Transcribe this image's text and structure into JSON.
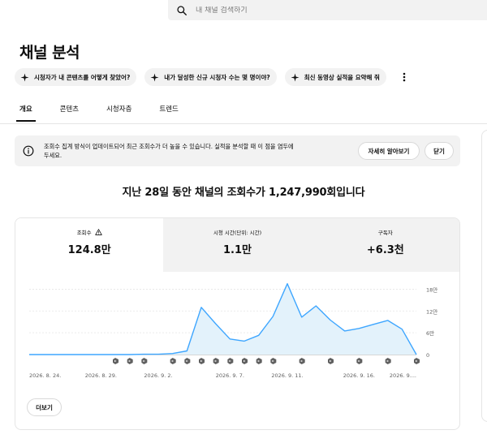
{
  "search": {
    "placeholder": "내 채널 검색하기"
  },
  "page_title": "채널 분석",
  "chips": [
    {
      "label": "시청자가 내 콘텐츠를 어떻게 찾았어?"
    },
    {
      "label": "내가 달성한 신규 시청자 수는 몇 명이야?"
    },
    {
      "label": "최신 동영상 실적을 요약해 줘"
    }
  ],
  "tabs": [
    {
      "label": "개요",
      "active": true
    },
    {
      "label": "콘텐츠",
      "active": false
    },
    {
      "label": "시청자층",
      "active": false
    },
    {
      "label": "트렌드",
      "active": false
    }
  ],
  "banner": {
    "line1": "조회수 집계 방식이 업데이트되어 최근 조회수가 더 높을 수 있습니다. 실적을 분석할 때 이 점을 염두에",
    "line2": "두세요.",
    "learn_more": "자세히 알아보기",
    "dismiss": "닫기"
  },
  "headline": "지난 28일 동안 채널의 조회수가 1,247,990회입니다",
  "metrics": [
    {
      "label": "조회수",
      "value": "124.8만",
      "warning": true
    },
    {
      "label": "시청 시간(단위: 시간)",
      "value": "1.1만"
    },
    {
      "label": "구독자",
      "value": "+6.3천"
    }
  ],
  "more_button": "더보기",
  "colors": {
    "line": "#3ea6ff",
    "fill": "#e3f2fb",
    "marker": "#606060"
  },
  "chart_data": {
    "type": "area",
    "x": [
      "2026. 8. 24.",
      "2026. 8. 25.",
      "2026. 8. 26.",
      "2026. 8. 27.",
      "2026. 8. 28.",
      "2026. 8. 29.",
      "2026. 8. 30.",
      "2026. 8. 31.",
      "2026. 9. 1.",
      "2026. 9. 2.",
      "2026. 9. 3.",
      "2026. 9. 4.",
      "2026. 9. 5.",
      "2026. 9. 6.",
      "2026. 9. 7.",
      "2026. 9. 8.",
      "2026. 9. 9.",
      "2026. 9. 10.",
      "2026. 9. 11.",
      "2026. 9. 12.",
      "2026. 9. 13.",
      "2026. 9. 14.",
      "2026. 9. 15.",
      "2026. 9. 16.",
      "2026. 9. 17.",
      "2026. 9. 18.",
      "2026. 9. 19.",
      "2026. 9. 20."
    ],
    "values": [
      0,
      0,
      0,
      0,
      0,
      0,
      0,
      0,
      0.1,
      0.1,
      0.3,
      1,
      13,
      8.5,
      4.3,
      3.7,
      5.3,
      10.5,
      19.5,
      10.3,
      13.4,
      9.5,
      6.5,
      7.2,
      8.3,
      9.4,
      7,
      0
    ],
    "tick_labels": [
      "2026. 8. 24.",
      "2026. 8. 29.",
      "2026. 9. 2.",
      "2026. 9. 7.",
      "2026. 9. 11.",
      "2026. 9. 16.",
      "2026. 9...."
    ],
    "tick_indices": [
      0,
      5,
      9,
      14,
      18,
      23,
      27
    ],
    "y_ticks": [
      0,
      6,
      12,
      18
    ],
    "y_tick_labels": [
      "0",
      "6만",
      "12만",
      "18만"
    ],
    "ylim": [
      0,
      21
    ],
    "marker_indices": [
      6,
      7,
      8,
      10,
      11,
      12,
      13,
      14,
      15,
      16,
      17,
      19,
      21,
      23,
      25,
      27
    ],
    "grid": true
  }
}
